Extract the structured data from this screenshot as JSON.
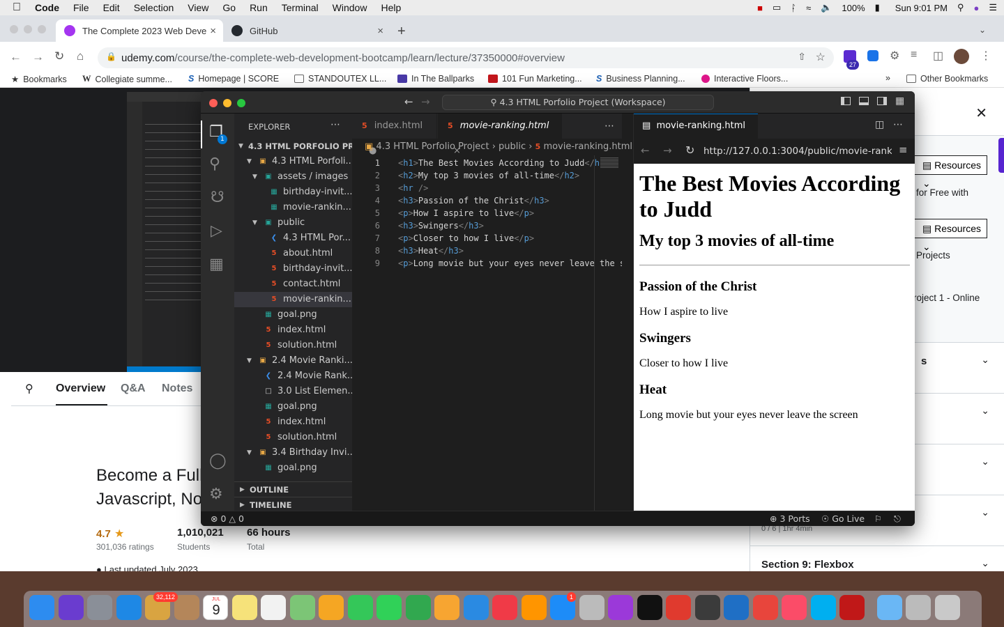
{
  "menubar": {
    "app": "Code",
    "items": [
      "File",
      "Edit",
      "Selection",
      "View",
      "Go",
      "Run",
      "Terminal",
      "Window",
      "Help"
    ],
    "battery": "100%",
    "clock": "Sun 9:01 PM"
  },
  "browser": {
    "tabs": [
      {
        "title": "The Complete 2023 Web Deve",
        "active": true
      },
      {
        "title": "GitHub",
        "active": false
      }
    ],
    "url_host": "udemy.com",
    "url_path": "/course/the-complete-web-development-bootcamp/learn/lecture/37350000#overview",
    "extension_badge": "27",
    "bookmarks": [
      "Bookmarks",
      "Collegiate summe...",
      "Homepage | SCORE",
      "STANDOUTEX LL...",
      "In The Ballparks",
      "101 Fun Marketing...",
      "Business Planning...",
      "Interactive Floors...",
      "Other Bookmarks"
    ]
  },
  "udemy": {
    "nav_tabs": [
      "Overview",
      "Q&A",
      "Notes"
    ],
    "course_title_line1": "Become a Full",
    "course_title_line2": "Javascript, No",
    "rating": "4.7",
    "ratings_count": "301,036 ratings",
    "students": "1,010,021",
    "students_label": "Students",
    "hours": "66 hours",
    "hours_label": "Total",
    "last_updated": "Last updated July 2023",
    "sidebar": {
      "resources1": "Resources",
      "free_text": "for Free with",
      "resources2": "Resources",
      "projects": "Projects",
      "project1": "roject 1 - Online",
      "s_letter": "s",
      "duration_partial": "0 / 6 | 1hr 4min",
      "section9": "Section 9: Flexbox"
    }
  },
  "vscode": {
    "command_center": "4.3 HTML Porfolio Project (Workspace)",
    "explorer_title": "EXPLORER",
    "badge": "1",
    "workspace": "4.3 HTML PORFOLIO PR...",
    "tree": [
      {
        "label": "4.3 HTML Porfoli...",
        "type": "folder",
        "indent": 1
      },
      {
        "label": "assets / images",
        "type": "imgfolder",
        "indent": 2
      },
      {
        "label": "birthday-invit...",
        "type": "img",
        "indent": 3
      },
      {
        "label": "movie-rankin...",
        "type": "img",
        "indent": 3
      },
      {
        "label": "public",
        "type": "imgfolder",
        "indent": 2
      },
      {
        "label": "4.3 HTML Por...",
        "type": "vs",
        "indent": 3
      },
      {
        "label": "about.html",
        "type": "html",
        "indent": 3
      },
      {
        "label": "birthday-invit...",
        "type": "html",
        "indent": 3
      },
      {
        "label": "contact.html",
        "type": "html",
        "indent": 3
      },
      {
        "label": "movie-rankin...",
        "type": "html",
        "indent": 3,
        "selected": true
      },
      {
        "label": "goal.png",
        "type": "img",
        "indent": 2
      },
      {
        "label": "index.html",
        "type": "html",
        "indent": 2
      },
      {
        "label": "solution.html",
        "type": "html",
        "indent": 2
      },
      {
        "label": "2.4 Movie Ranki...",
        "type": "folder",
        "indent": 1
      },
      {
        "label": "2.4 Movie Rank...",
        "type": "vs",
        "indent": 2
      },
      {
        "label": "3.0 List Elemen...",
        "type": "file",
        "indent": 2
      },
      {
        "label": "goal.png",
        "type": "img",
        "indent": 2
      },
      {
        "label": "index.html",
        "type": "html",
        "indent": 2
      },
      {
        "label": "solution.html",
        "type": "html",
        "indent": 2
      },
      {
        "label": "3.4 Birthday Invi...",
        "type": "folder",
        "indent": 1
      },
      {
        "label": "goal.png",
        "type": "img",
        "indent": 2
      }
    ],
    "outline": "OUTLINE",
    "timeline": "TIMELINE",
    "editor_tabs": [
      "index.html",
      "movie-ranking.html"
    ],
    "breadcrumb": [
      "4.3 HTML Porfolio Project",
      "public",
      "movie-ranking.html"
    ],
    "code": [
      {
        "n": "1",
        "tag": "h1",
        "text": "The Best Movies According to Judd"
      },
      {
        "n": "2",
        "tag": "h2",
        "text": "My top 3 movies of all-time"
      },
      {
        "n": "3",
        "tag": "hr",
        "text": ""
      },
      {
        "n": "4",
        "tag": "h3",
        "text": "Passion of the Christ"
      },
      {
        "n": "5",
        "tag": "p",
        "text": "How I aspire to live"
      },
      {
        "n": "6",
        "tag": "h3",
        "text": "Swingers"
      },
      {
        "n": "7",
        "tag": "p",
        "text": "Closer to how I live"
      },
      {
        "n": "8",
        "tag": "h3",
        "text": "Heat"
      },
      {
        "n": "9",
        "tag": "p",
        "text": "Long movie but your eyes never leave the screen"
      }
    ],
    "preview_tab": "movie-ranking.html",
    "preview_url": "http://127.0.0.1:3004/public/movie-ranking.html",
    "status_errors": "0",
    "status_warnings": "0",
    "status_ports": "3 Ports",
    "status_golive": "Go Live"
  },
  "dock": {
    "mail_badge": "32,112",
    "calendar_month": "JUL",
    "calendar_day": "9",
    "appstore_badge": "1"
  }
}
